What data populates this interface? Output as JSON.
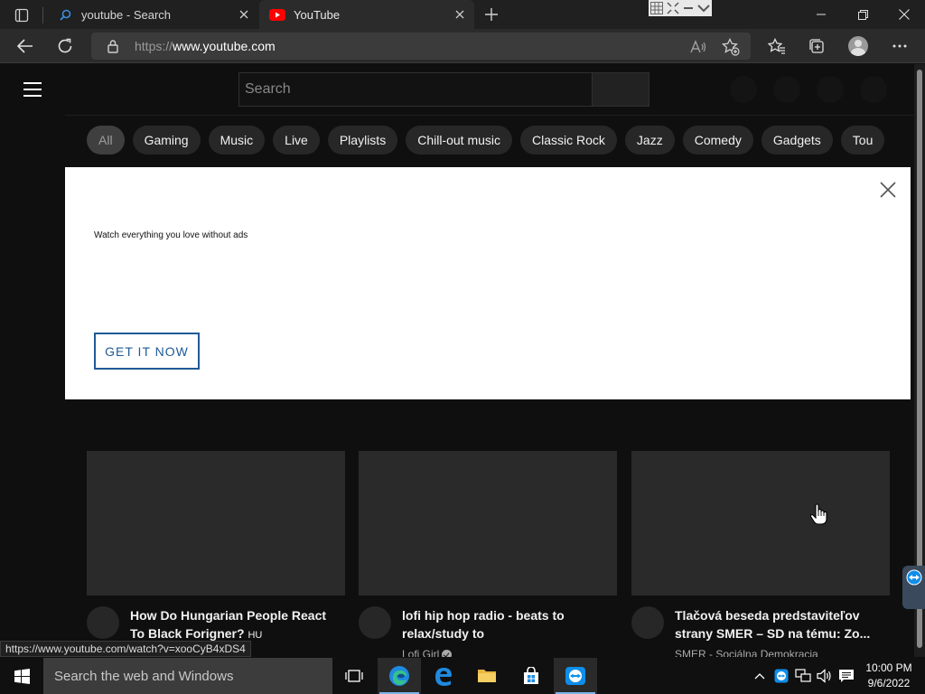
{
  "browser": {
    "tabs": [
      {
        "title": "youtube - Search",
        "icon": "search-icon"
      },
      {
        "title": "YouTube",
        "icon": "youtube-logo-icon"
      }
    ],
    "url": {
      "protocol": "https://",
      "host": "www.youtube.com"
    },
    "status_url": "https://www.youtube.com/watch?v=xooCyB4xDS4"
  },
  "youtube": {
    "search_placeholder": "Search",
    "chips": [
      {
        "label": "All",
        "selected": true
      },
      {
        "label": "Gaming"
      },
      {
        "label": "Music"
      },
      {
        "label": "Live"
      },
      {
        "label": "Playlists"
      },
      {
        "label": "Chill-out music"
      },
      {
        "label": "Classic Rock"
      },
      {
        "label": "Jazz"
      },
      {
        "label": "Comedy"
      },
      {
        "label": "Gadgets"
      },
      {
        "label": "Tou"
      }
    ],
    "banner": {
      "text": "Watch everything you love without ads",
      "button_label": "GET IT NOW"
    },
    "videos": [
      {
        "title": "How Do Hungarian People React To Black Forigner?",
        "title_suffix": "HU",
        "channel": ""
      },
      {
        "title": "lofi hip hop radio - beats to relax/study to",
        "channel": "Lofi Girl",
        "verified": true
      },
      {
        "title": "Tlačová beseda predstaviteľov strany SMER – SD na tému: Zo...",
        "channel": "SMER - Sociálna Demokracia"
      }
    ]
  },
  "taskbar": {
    "search_placeholder": "Search the web and Windows",
    "time": "10:00 PM",
    "date": "9/6/2022"
  }
}
